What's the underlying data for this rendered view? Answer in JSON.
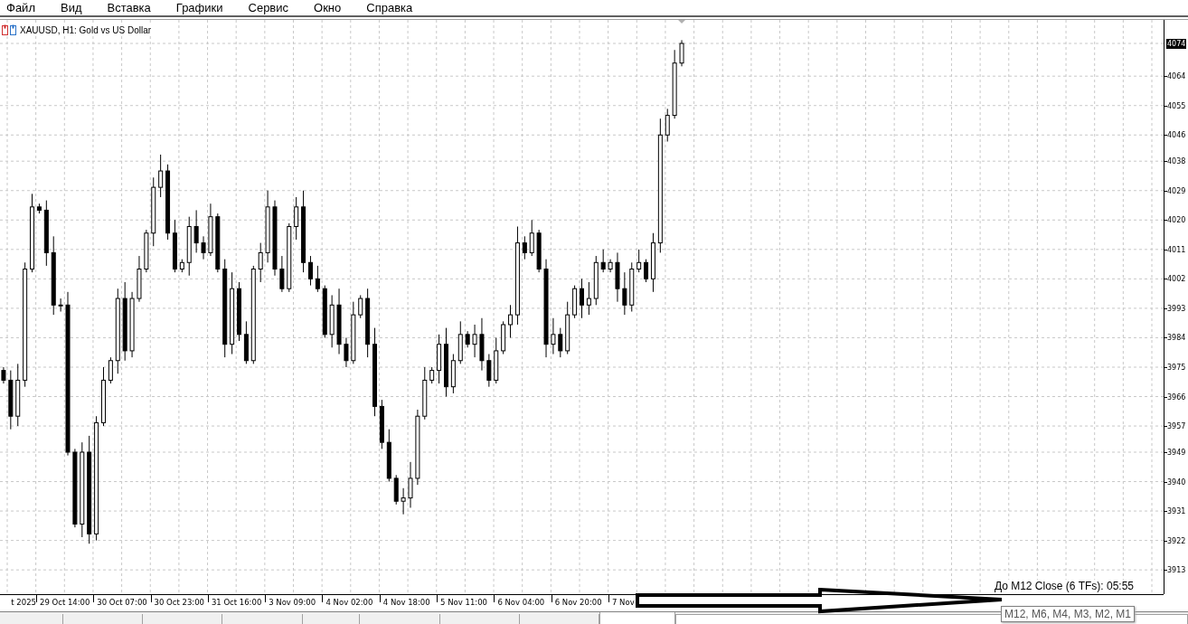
{
  "menu": [
    "Файл",
    "Вид",
    "Вставка",
    "Графики",
    "Сервис",
    "Окно",
    "Справка"
  ],
  "chart": {
    "title": "XAUUSD, H1:  Gold vs US Dollar",
    "current_price": "4074",
    "chart_data": {
      "type": "candlestick",
      "ylim": [
        3905.3,
        4081.2
      ],
      "yticks": [
        {
          "value": 4064,
          "label": "4064"
        },
        {
          "value": 4055,
          "label": "4055"
        },
        {
          "value": 4046,
          "label": "4046"
        },
        {
          "value": 4038,
          "label": "4038"
        },
        {
          "value": 4029,
          "label": "4029"
        },
        {
          "value": 4020,
          "label": "4020"
        },
        {
          "value": 4011,
          "label": "4011"
        },
        {
          "value": 4002,
          "label": "4002"
        },
        {
          "value": 3993,
          "label": "3993"
        },
        {
          "value": 3984,
          "label": "3984"
        },
        {
          "value": 3975,
          "label": "3975"
        },
        {
          "value": 3966,
          "label": "3966"
        },
        {
          "value": 3957,
          "label": "3957"
        },
        {
          "value": 3949,
          "label": "3949"
        },
        {
          "value": 3940,
          "label": "3940"
        },
        {
          "value": 3931,
          "label": "3931"
        },
        {
          "value": 3922,
          "label": "3922"
        },
        {
          "value": 3913,
          "label": "3913"
        }
      ],
      "grid": true,
      "categories": [
        null,
        null,
        null,
        null,
        null,
        null,
        null,
        null,
        null,
        null,
        null,
        null,
        null,
        null,
        null,
        null,
        null,
        null,
        null,
        null,
        null,
        null,
        null,
        null,
        null,
        null,
        null,
        null,
        null,
        null,
        null,
        null,
        null,
        null,
        null,
        null,
        null,
        null,
        null,
        null,
        null,
        null,
        null,
        null,
        null,
        null,
        null,
        null,
        null,
        null,
        null,
        null,
        null,
        null,
        null,
        null,
        null,
        null,
        null,
        null,
        null,
        null,
        null,
        null,
        null,
        null,
        null,
        null,
        null,
        null,
        null,
        null,
        null,
        null,
        null,
        null,
        null,
        null,
        null,
        null,
        null,
        null,
        null,
        null,
        null,
        null,
        null,
        null,
        null,
        null,
        null,
        null,
        null,
        null,
        null,
        null,
        null,
        null,
        null,
        null,
        null,
        null,
        null,
        null,
        null,
        null,
        null,
        null,
        null,
        null,
        null,
        null,
        null,
        null,
        null,
        null,
        null,
        null,
        null,
        null,
        null,
        null,
        null,
        null,
        null,
        null,
        null,
        null,
        null,
        null,
        null,
        null,
        null,
        null,
        null,
        null,
        null,
        null,
        null,
        null,
        null,
        null,
        null,
        null,
        null,
        null,
        null,
        null,
        null,
        null,
        null,
        null,
        null,
        null,
        null,
        null,
        null,
        null,
        null,
        null,
        null,
        null,
        null
      ],
      "ohlc": [
        [
          3974,
          3975,
          3970,
          3971
        ],
        [
          3971,
          3974,
          3956,
          3960
        ],
        [
          3960,
          3976,
          3957,
          3971
        ],
        [
          3971,
          4007,
          3969,
          4005
        ],
        [
          4005,
          4028,
          4004,
          4024
        ],
        [
          4024,
          4025,
          4022,
          4023
        ],
        [
          4023,
          4026,
          4006,
          4010
        ],
        [
          4010,
          4015,
          3991,
          3994
        ],
        [
          3994,
          3996,
          3992,
          3994
        ],
        [
          3994,
          3998,
          3948,
          3949
        ],
        [
          3949,
          3950,
          3926,
          3927
        ],
        [
          3927,
          3952,
          3923,
          3949
        ],
        [
          3949,
          3954,
          3921,
          3924
        ],
        [
          3924,
          3960,
          3922,
          3958
        ],
        [
          3958,
          3975,
          3957,
          3971
        ],
        [
          3971,
          3978,
          3970,
          3977
        ],
        [
          3977,
          3999,
          3973,
          3996
        ],
        [
          3996,
          4001,
          3977,
          3980
        ],
        [
          3980,
          3998,
          3978,
          3996
        ],
        [
          3996,
          4009,
          3995,
          4005
        ],
        [
          4005,
          4017,
          4004,
          4016
        ],
        [
          4016,
          4033,
          4012,
          4030
        ],
        [
          4030,
          4040,
          4027,
          4035
        ],
        [
          4035,
          4037,
          4014,
          4016
        ],
        [
          4016,
          4020,
          4004,
          4005
        ],
        [
          4005,
          4008,
          4004,
          4007
        ],
        [
          4007,
          4021,
          4003,
          4018
        ],
        [
          4018,
          4023,
          4010,
          4013
        ],
        [
          4013,
          4015,
          4008,
          4010
        ],
        [
          4010,
          4025,
          4009,
          4021
        ],
        [
          4021,
          4022,
          4004,
          4005
        ],
        [
          4005,
          4008,
          3978,
          3982
        ],
        [
          3982,
          4004,
          3979,
          3999
        ],
        [
          3999,
          4001,
          3983,
          3985
        ],
        [
          3985,
          3989,
          3976,
          3977
        ],
        [
          3977,
          4006,
          3976,
          4005
        ],
        [
          4005,
          4013,
          4001,
          4010
        ],
        [
          4010,
          4029,
          4007,
          4024
        ],
        [
          4024,
          4026,
          4003,
          4005
        ],
        [
          4005,
          4009,
          3998,
          3999
        ],
        [
          3999,
          4019,
          3998,
          4018
        ],
        [
          4018,
          4027,
          4014,
          4024
        ],
        [
          4024,
          4029,
          4004,
          4007
        ],
        [
          4007,
          4009,
          4000,
          4002
        ],
        [
          4002,
          4006,
          3998,
          3999
        ],
        [
          3999,
          4000,
          3984,
          3985
        ],
        [
          3985,
          3997,
          3981,
          3994
        ],
        [
          3994,
          3999,
          3979,
          3982
        ],
        [
          3982,
          3984,
          3975,
          3977
        ],
        [
          3977,
          3995,
          3976,
          3991
        ],
        [
          3991,
          3997,
          3990,
          3996
        ],
        [
          3996,
          3999,
          3978,
          3982
        ],
        [
          3982,
          3987,
          3960,
          3963
        ],
        [
          3963,
          3965,
          3950,
          3952
        ],
        [
          3952,
          3956,
          3940,
          3941
        ],
        [
          3941,
          3942,
          3933,
          3934
        ],
        [
          3934,
          3938,
          3930,
          3935
        ],
        [
          3935,
          3946,
          3932,
          3941
        ],
        [
          3941,
          3962,
          3939,
          3960
        ],
        [
          3960,
          3975,
          3959,
          3971
        ],
        [
          3971,
          3975,
          3970,
          3974
        ],
        [
          3974,
          3985,
          3970,
          3982
        ],
        [
          3982,
          3987,
          3966,
          3969
        ],
        [
          3969,
          3979,
          3967,
          3977
        ],
        [
          3977,
          3989,
          3976,
          3985
        ],
        [
          3985,
          3986,
          3981,
          3982
        ],
        [
          3982,
          3988,
          3978,
          3985
        ],
        [
          3985,
          3990,
          3974,
          3977
        ],
        [
          3977,
          3979,
          3969,
          3971
        ],
        [
          3971,
          3984,
          3970,
          3980
        ],
        [
          3980,
          3989,
          3979,
          3988
        ],
        [
          3988,
          3994,
          3984,
          3991
        ],
        [
          3991,
          4018,
          3988,
          4013
        ],
        [
          4013,
          4015,
          4008,
          4010
        ],
        [
          4010,
          4020,
          4009,
          4016
        ],
        [
          4016,
          4017,
          4004,
          4005
        ],
        [
          4005,
          4008,
          3978,
          3982
        ],
        [
          3982,
          3990,
          3979,
          3985
        ],
        [
          3985,
          3987,
          3978,
          3980
        ],
        [
          3980,
          3995,
          3979,
          3991
        ],
        [
          3991,
          4000,
          3990,
          3999
        ],
        [
          3999,
          4002,
          3990,
          3994
        ],
        [
          3994,
          4001,
          3991,
          3996
        ],
        [
          3996,
          4009,
          3994,
          4007
        ],
        [
          4007,
          4011,
          4004,
          4005
        ],
        [
          4005,
          4008,
          4004,
          4007
        ],
        [
          4007,
          4010,
          3995,
          3999
        ],
        [
          3999,
          4004,
          3991,
          3994
        ],
        [
          3994,
          4007,
          3992,
          4005
        ],
        [
          4005,
          4011,
          4004,
          4007
        ],
        [
          4007,
          4008,
          4001,
          4002
        ],
        [
          4002,
          4016,
          3998,
          4013
        ],
        [
          4013,
          4051,
          4010,
          4046
        ],
        [
          4046,
          4054,
          4044,
          4052
        ],
        [
          4052,
          4072,
          4051,
          4068
        ],
        [
          4068,
          4075,
          4067,
          4074
        ],
        null,
        null,
        null,
        null,
        null,
        null,
        null,
        null,
        null,
        null,
        null,
        null,
        null,
        null,
        null,
        null,
        null,
        null,
        null,
        null,
        null,
        null,
        null,
        null,
        null,
        null,
        null,
        null,
        null,
        null,
        null,
        null,
        null,
        null,
        null,
        null,
        null,
        null,
        null,
        null,
        null,
        null,
        null,
        null,
        null,
        null,
        null,
        null,
        null,
        null,
        null,
        null,
        null,
        null,
        null,
        null,
        null,
        null,
        null,
        null,
        null,
        null,
        null,
        null,
        null,
        null,
        null
      ]
    },
    "time_axis": [
      "t 2025",
      "29 Oct 14:00",
      "30 Oct 07:00",
      "30 Oct 23:00",
      "31 Oct 16:00",
      "3 Nov 09:00",
      "4 Nov 02:00",
      "4 Nov 18:00",
      "5 Nov 11:00",
      "6 Nov 04:00",
      "6 Nov 20:00",
      "7 Nov"
    ],
    "countdown": "До M12 Close (6 TFs): 05:55",
    "tooltip": "M12, M6, M4, M3, M2, M1"
  },
  "tabs": [
    {
      "selected": false
    },
    {
      "selected": false
    },
    {
      "selected": false
    },
    {
      "selected": false
    },
    {
      "selected": false
    },
    {
      "selected": false
    },
    {
      "selected": false
    },
    {
      "selected": false
    },
    {
      "selected": true
    }
  ]
}
